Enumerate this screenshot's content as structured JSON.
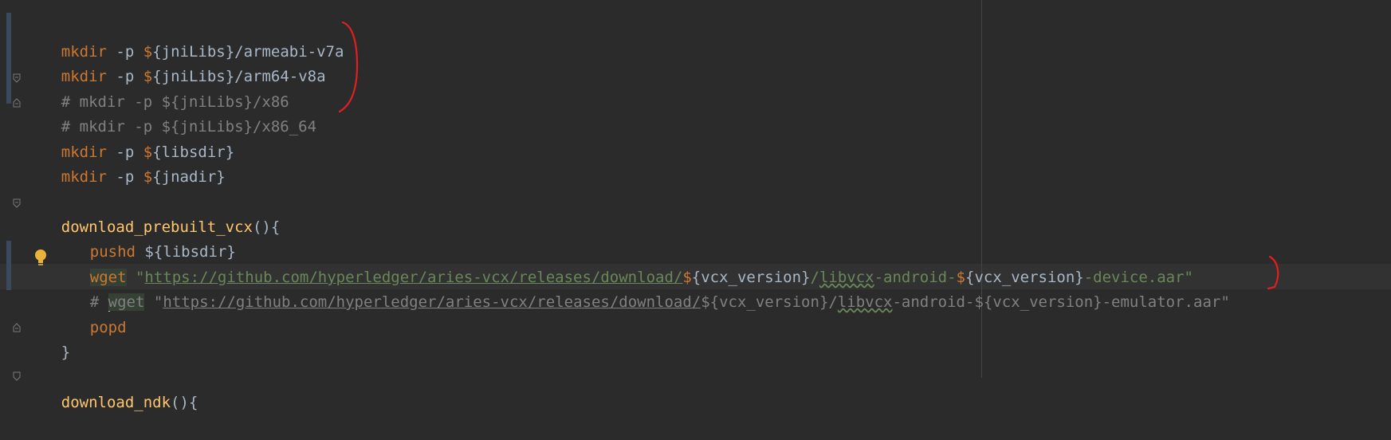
{
  "editor": {
    "lines": [
      {
        "prefix_kw": "mkdir",
        "args": " -p ",
        "dollar": "$",
        "var": "{jniLibs}",
        "tail": "/armeabi-v7a"
      },
      {
        "prefix_kw": "mkdir",
        "args": " -p ",
        "dollar": "$",
        "var": "{jniLibs}",
        "tail": "/arm64-v8a"
      },
      {
        "comment": "# mkdir -p ${jniLibs}/x86"
      },
      {
        "comment": "# mkdir -p ${jniLibs}/x86_64"
      },
      {
        "prefix_kw": "mkdir",
        "args": " -p ",
        "dollar": "$",
        "var": "{libsdir}",
        "tail": ""
      },
      {
        "prefix_kw": "mkdir",
        "args": " -p ",
        "dollar": "$",
        "var": "{jnadir}",
        "tail": ""
      }
    ],
    "func1": {
      "name": "download_prebuilt_vcx",
      "parens": "()",
      "brace_open": "{",
      "brace_close": "}"
    },
    "pushd": {
      "kw": "pushd",
      "arg": " ${libsdir}"
    },
    "wget1": {
      "kw": "wget",
      "quote_open": " \"",
      "url": "https://github.com/hyperledger/aries-vcx/releases/download/",
      "dollar": "$",
      "var1": "{vcx_version}",
      "slash": "/",
      "lib": "libvcx",
      "mid": "-android-",
      "dollar2": "$",
      "var2": "{vcx_version}",
      "suffix": "-device.aar\""
    },
    "wget2": {
      "hash": "# ",
      "kw": "wget",
      "quote_open": " \"",
      "url": "https://github.com/hyperledger/aries-vcx/releases/download/",
      "dollar": "$",
      "var1": "{vcx_version}",
      "slash": "/",
      "lib": "libvcx",
      "mid": "-android-",
      "dollar2": "$",
      "var2": "{vcx_version}",
      "suffix": "-emulator.aar\""
    },
    "popd": {
      "kw": "popd"
    },
    "func2": {
      "name": "download_ndk",
      "parens": "()",
      "brace_open": "{"
    }
  },
  "colors": {
    "background": "#2b2b2b",
    "keyword": "#cc7832",
    "function": "#ffc66d",
    "comment": "#808080",
    "string": "#6a8759",
    "text": "#a9b7c6",
    "annotation": "#ff0000"
  }
}
